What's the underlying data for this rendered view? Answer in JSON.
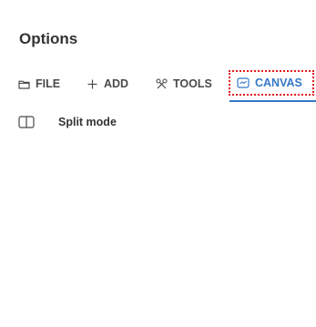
{
  "header": {
    "title": "Options"
  },
  "tabs": [
    {
      "label": "FILE",
      "icon": "folder-icon"
    },
    {
      "label": "ADD",
      "icon": "plus-icon"
    },
    {
      "label": "TOOLS",
      "icon": "tools-icon"
    },
    {
      "label": "CANVAS",
      "icon": "canvas-icon",
      "selected": true
    }
  ],
  "menu": {
    "items": [
      {
        "label": "Split mode",
        "icon": "split-view-icon"
      }
    ]
  },
  "colors": {
    "accent": "#3478c6",
    "highlight_outline": "#e11a1a",
    "text": "#333333"
  }
}
